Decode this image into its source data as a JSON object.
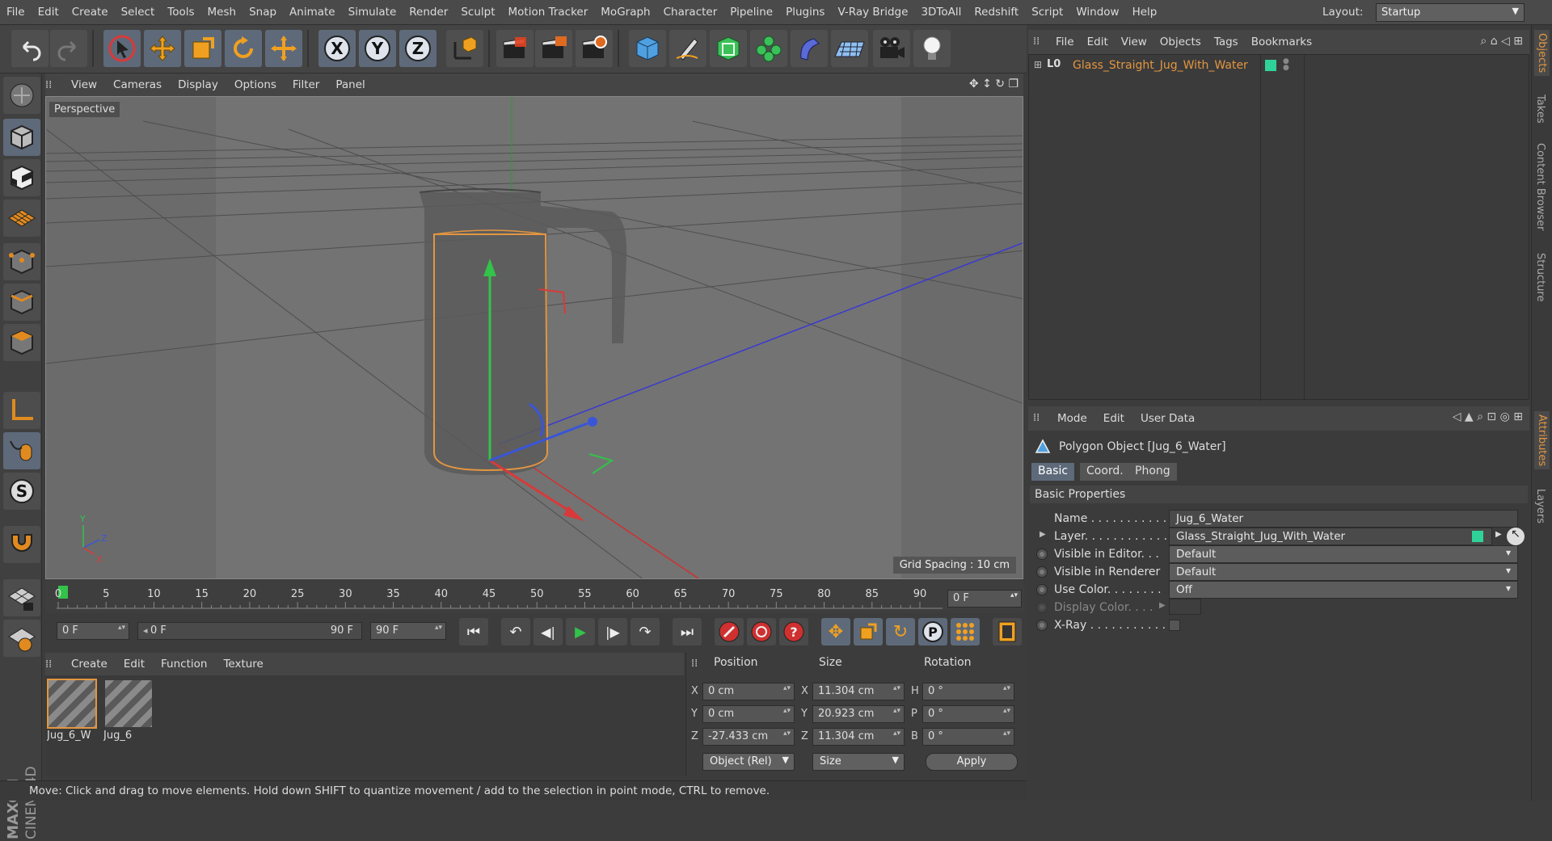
{
  "menubar": {
    "items": [
      "File",
      "Edit",
      "Create",
      "Select",
      "Tools",
      "Mesh",
      "Snap",
      "Animate",
      "Simulate",
      "Render",
      "Sculpt",
      "Motion Tracker",
      "MoGraph",
      "Character",
      "Pipeline",
      "Plugins",
      "V-Ray Bridge",
      "3DToAll",
      "Redshift",
      "Script",
      "Window",
      "Help"
    ],
    "layout_label": "Layout:",
    "layout_value": "Startup"
  },
  "toolbar": {
    "axis_x": "X",
    "axis_y": "Y",
    "axis_z": "Z"
  },
  "viewport": {
    "menu": [
      "View",
      "Cameras",
      "Display",
      "Options",
      "Filter",
      "Panel"
    ],
    "camera_label": "Perspective",
    "grid_spacing": "Grid Spacing : 10 cm",
    "axis_y": "Y",
    "axis_z": "Z",
    "axis_x": "X"
  },
  "timeline": {
    "ticks": [
      "0",
      "5",
      "10",
      "15",
      "20",
      "25",
      "30",
      "35",
      "40",
      "45",
      "50",
      "55",
      "60",
      "65",
      "70",
      "75",
      "80",
      "85",
      "90"
    ],
    "current_frame": "0 F"
  },
  "transport": {
    "start_frame": "0 F",
    "range_start": "0 F",
    "range_end": "90 F",
    "end_frame": "90 F"
  },
  "materials": {
    "menu": [
      "Create",
      "Edit",
      "Function",
      "Texture"
    ],
    "items": [
      {
        "name": "Jug_6_W",
        "selected": true
      },
      {
        "name": "Jug_6",
        "selected": false
      }
    ]
  },
  "coords": {
    "headers": {
      "position": "Position",
      "size": "Size",
      "rotation": "Rotation"
    },
    "axes": [
      "X",
      "Y",
      "Z"
    ],
    "size_axes": [
      "X",
      "Y",
      "Z"
    ],
    "rot_axes": [
      "H",
      "P",
      "B"
    ],
    "position": [
      "0 cm",
      "0 cm",
      "-27.433 cm"
    ],
    "size": [
      "11.304 cm",
      "20.923 cm",
      "11.304 cm"
    ],
    "rotation": [
      "0 °",
      "0 °",
      "0 °"
    ],
    "mode": "Object (Rel)",
    "size_mode": "Size",
    "apply": "Apply"
  },
  "status": {
    "text": "Move: Click and drag to move elements. Hold down SHIFT to quantize movement / add to the selection in point mode, CTRL to remove."
  },
  "objects": {
    "menu": [
      "File",
      "Edit",
      "View",
      "Objects",
      "Tags",
      "Bookmarks"
    ],
    "tree": [
      {
        "name": "Glass_Straight_Jug_With_Water",
        "color": "#e39640"
      }
    ]
  },
  "attributes": {
    "menu": [
      "Mode",
      "Edit",
      "User Data"
    ],
    "title": "Polygon Object [Jug_6_Water]",
    "tabs": [
      "Basic",
      "Coord.",
      "Phong"
    ],
    "active_tab": "Basic",
    "section": "Basic Properties",
    "rows": {
      "name_label": "Name . . . . . . . . . . .",
      "name_value": "Jug_6_Water",
      "layer_label": "Layer. . . . . . . . . . . .",
      "layer_value": "Glass_Straight_Jug_With_Water",
      "vis_editor_label": "Visible in Editor. . .",
      "vis_editor_value": "Default",
      "vis_render_label": "Visible in Renderer",
      "vis_render_value": "Default",
      "use_color_label": "Use Color. . . . . . . .",
      "use_color_value": "Off",
      "display_color_label": "Display Color. . . .",
      "xray_label": "X-Ray . . . . . . . . . . ."
    }
  },
  "side_tabs": [
    "Objects",
    "Takes",
    "Content Browser",
    "Structure",
    "Attributes",
    "Layers"
  ],
  "colors": {
    "accent": "#e39640",
    "layer_swatch": "#2fd39a",
    "axis_x": "#d83a3a",
    "axis_y": "#33c24a",
    "axis_z": "#3a55d8"
  }
}
